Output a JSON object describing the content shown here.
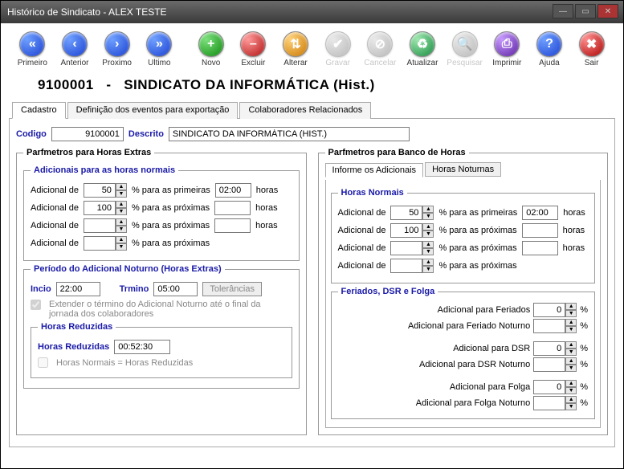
{
  "window": {
    "title": "Histórico de Sindicato - ALEX TESTE"
  },
  "toolbar": {
    "primeiro": "Primeiro",
    "anterior": "Anterior",
    "proximo": "Proximo",
    "ultimo": "Ultimo",
    "novo": "Novo",
    "excluir": "Excluir",
    "alterar": "Alterar",
    "gravar": "Gravar",
    "cancelar": "Cancelar",
    "atualizar": "Atualizar",
    "pesquisar": "Pesquisar",
    "imprimir": "Imprimir",
    "ajuda": "Ajuda",
    "sair": "Sair"
  },
  "header": {
    "codigo": "9100001",
    "sep": "-",
    "nome": "SINDICATO DA INFORMÁTICA (Hist.)"
  },
  "tabs": {
    "cadastro": "Cadastro",
    "definicao": "Definição dos eventos para exportação",
    "colab": "Colaboradores Relacionados"
  },
  "cadastro": {
    "codigo_label": "Codigo",
    "codigo": "9100001",
    "descricao_label": "Descrito",
    "descricao": "SINDICATO DA INFORMÁTICA (HIST.)"
  },
  "left": {
    "legend": "Parfmetros para Horas Extras",
    "adic_legend": "Adicionais para as horas normais",
    "ad_label": "Adicional de",
    "pct_primeiras": "% para as primeiras",
    "pct_proximas": "% para as próximas",
    "horas": "horas",
    "v1": "50",
    "h1": "02:00",
    "v2": "100",
    "h2": "",
    "v3": "",
    "h3": "",
    "v4": "",
    "periodo_legend": "Período do Adicional Noturno (Horas Extras)",
    "inicio_label": "Incio",
    "inicio": "22:00",
    "termino_label": "Trmino",
    "termino": "05:00",
    "tolerancias": "Tolerâncias",
    "extender": "Extender o término do Adicional Noturno até o final da jornada dos colaboradores",
    "hr_legend": "Horas Reduzidas",
    "hr_label": "Horas Reduzidas",
    "hr_value": "00:52:30",
    "hr_chk": "Horas Normais = Horas Reduzidas"
  },
  "right": {
    "legend": "Parfmetros para Banco de Horas",
    "tab1": "Informe os Adicionais",
    "tab2": "Horas Noturnas",
    "hn_legend": "Horas Normais",
    "ad_label": "Adicional de",
    "pct_primeiras": "% para as primeiras",
    "pct_proximas": "% para as próximas",
    "horas": "horas",
    "v1": "50",
    "h1": "02:00",
    "v2": "100",
    "h2": "",
    "v3": "",
    "h3": "",
    "v4": "",
    "fdf_legend": "Feriados, DSR e  Folga",
    "af": "Adicional para Feriados",
    "af_v": "0",
    "afn": "Adicional para Feriado Noturno",
    "afn_v": "",
    "ad": "Adicional para  DSR",
    "ad_v": "0",
    "adn": "Adicional para DSR Noturno",
    "adn_v": "",
    "afl": "Adicional para Folga",
    "afl_v": "0",
    "afln": "Adicional para Folga Noturno",
    "afln_v": "",
    "pct": "%"
  }
}
